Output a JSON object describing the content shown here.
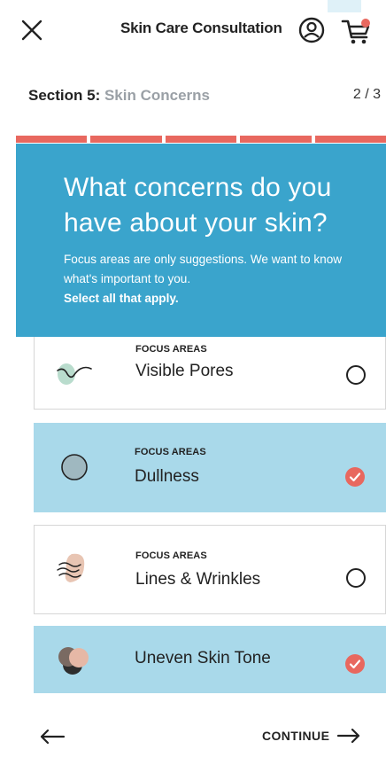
{
  "header": {
    "title": "Skin Care Consultation",
    "close_icon": "close-icon",
    "account_icon": "account-icon",
    "cart_icon": "cart-icon"
  },
  "section": {
    "prefix": "Section 5: ",
    "name": "Skin Concerns",
    "step": "2 / 3"
  },
  "progress": {
    "segments": 5,
    "color": "#e8685f"
  },
  "question": {
    "title": "What concerns do you have about your skin?",
    "description": "Focus areas are only suggestions. We want to know what's important to you.",
    "instruction": "Select all that apply."
  },
  "options": [
    {
      "kicker": "FOCUS AREAS",
      "label": "Visible Pores",
      "selected": false,
      "icon": "pores-icon"
    },
    {
      "kicker": "FOCUS AREAS",
      "label": "Dullness",
      "selected": true,
      "icon": "dullness-icon"
    },
    {
      "kicker": "FOCUS AREAS",
      "label": "Lines & Wrinkles",
      "selected": false,
      "icon": "wrinkles-icon"
    },
    {
      "kicker": "",
      "label": "Uneven Skin Tone",
      "selected": true,
      "icon": "skin-tone-icon"
    }
  ],
  "footer": {
    "continue_label": "CONTINUE",
    "back_icon": "back-arrow-icon",
    "forward_icon": "forward-arrow-icon"
  },
  "colors": {
    "accent": "#3aa4cc",
    "selected_bg": "#a9d9ea",
    "progress": "#e8685f",
    "check": "#e8685f"
  }
}
